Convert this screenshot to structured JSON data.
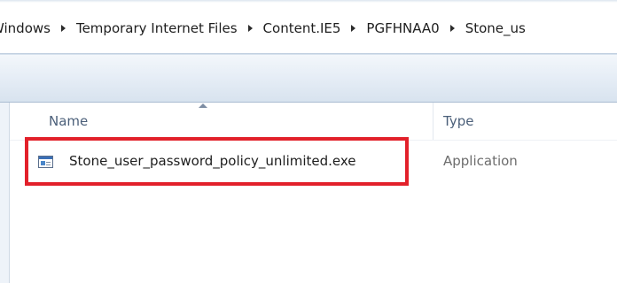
{
  "breadcrumb": {
    "items": [
      "Windows",
      "Temporary Internet Files",
      "Content.IE5",
      "PGFHNAA0",
      "Stone_us"
    ]
  },
  "columns": {
    "name": "Name",
    "type": "Type"
  },
  "files": [
    {
      "name": "Stone_user_password_policy_unlimited.exe",
      "type": "Application",
      "icon": "application-exe-icon"
    }
  ],
  "colors": {
    "highlight": "#e2202a",
    "header_text": "#4c607a",
    "toolbar": "#e4ecf5"
  }
}
